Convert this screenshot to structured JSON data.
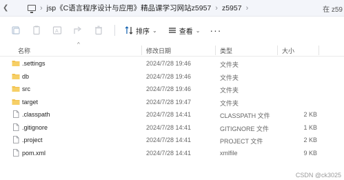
{
  "address": {
    "seg1": "jsp《C语言程序设计与应用》精品课学习网站z5957",
    "seg2": "z5957",
    "search_hint": "在 z59"
  },
  "toolbar": {
    "sort_label": "排序",
    "view_label": "查看",
    "more_label": "···"
  },
  "columns": {
    "name": "名称",
    "date": "修改日期",
    "type": "类型",
    "size": "大小"
  },
  "files": [
    {
      "name": ".settings",
      "date": "2024/7/28 19:46",
      "type": "文件夹",
      "size": "",
      "kind": "folder"
    },
    {
      "name": "db",
      "date": "2024/7/28 19:46",
      "type": "文件夹",
      "size": "",
      "kind": "folder"
    },
    {
      "name": "src",
      "date": "2024/7/28 19:46",
      "type": "文件夹",
      "size": "",
      "kind": "folder"
    },
    {
      "name": "target",
      "date": "2024/7/28 19:47",
      "type": "文件夹",
      "size": "",
      "kind": "folder"
    },
    {
      "name": ".classpath",
      "date": "2024/7/28 14:41",
      "type": "CLASSPATH 文件",
      "size": "2 KB",
      "kind": "file"
    },
    {
      "name": ".gitignore",
      "date": "2024/7/28 14:41",
      "type": "GITIGNORE 文件",
      "size": "1 KB",
      "kind": "file"
    },
    {
      "name": ".project",
      "date": "2024/7/28 14:41",
      "type": "PROJECT 文件",
      "size": "2 KB",
      "kind": "file"
    },
    {
      "name": "pom.xml",
      "date": "2024/7/28 14:41",
      "type": "xmlfile",
      "size": "9 KB",
      "kind": "file"
    }
  ],
  "watermark": "CSDN @ck3025",
  "colors": {
    "folder": "#f2c14e",
    "accent": "#0b5cad"
  }
}
